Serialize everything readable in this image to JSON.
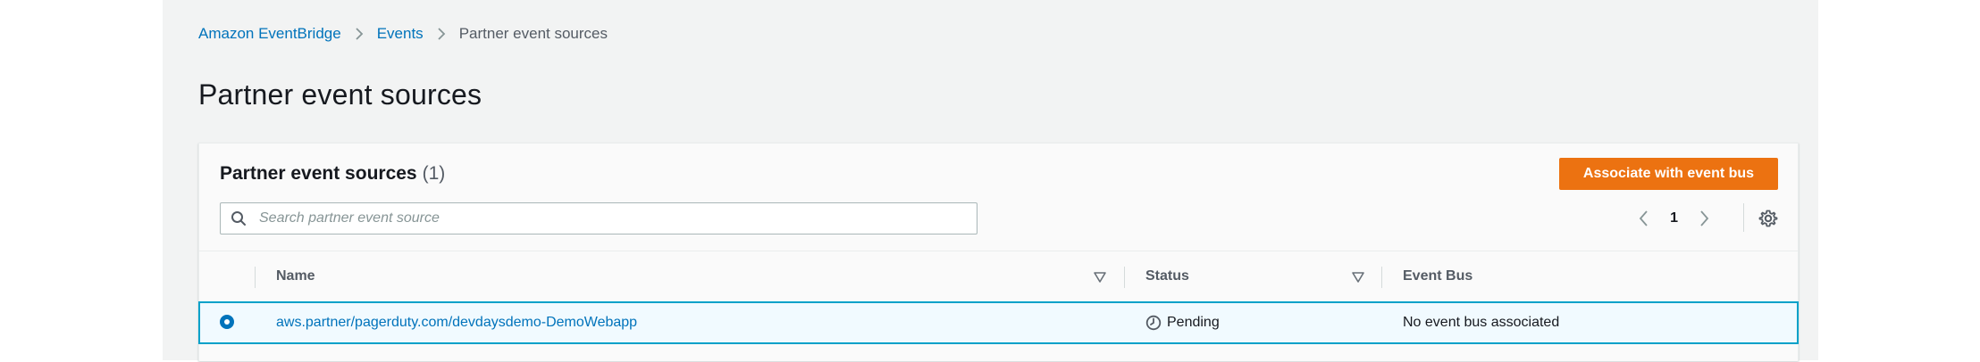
{
  "breadcrumb": {
    "items": [
      "Amazon EventBridge",
      "Events"
    ],
    "current": "Partner event sources"
  },
  "page": {
    "title": "Partner event sources"
  },
  "panel": {
    "title": "Partner event sources",
    "count": "(1)",
    "primary_button": "Associate with event bus",
    "search_placeholder": "Search partner event source",
    "pagination": {
      "current_page": "1"
    }
  },
  "table": {
    "columns": [
      "Name",
      "Status",
      "Event Bus"
    ],
    "rows": [
      {
        "selected": true,
        "name": "aws.partner/pagerduty.com/devdaysdemo-DemoWebapp",
        "status": "Pending",
        "event_bus": "No event bus associated"
      }
    ]
  },
  "colors": {
    "link": "#0073bb",
    "primary_button": "#ec7211",
    "selected_row_border": "#00a1c9",
    "selected_row_bg": "#f1faff"
  },
  "icons": [
    "chevron-right-icon",
    "search-icon",
    "chevron-left-icon",
    "gear-icon",
    "sort-down-icon",
    "clock-icon"
  ]
}
